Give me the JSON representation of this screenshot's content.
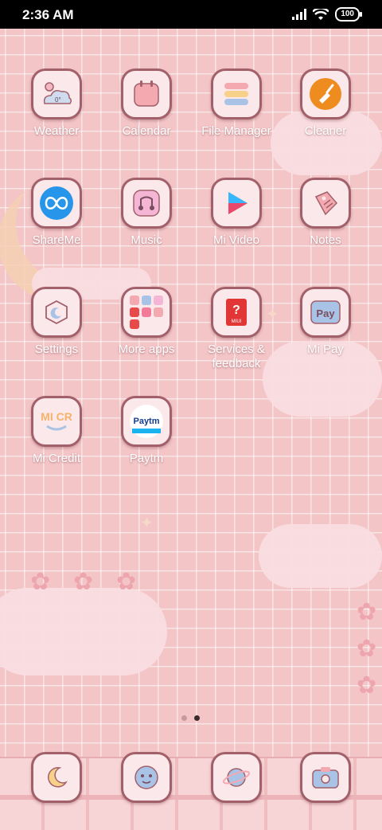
{
  "status_bar": {
    "time": "2:36 AM",
    "battery": "100"
  },
  "apps": [
    {
      "label": "Weather",
      "icon": "weather-icon",
      "badge": "0°"
    },
    {
      "label": "Calendar",
      "icon": "calendar-icon"
    },
    {
      "label": "File Manager",
      "icon": "file-manager-icon"
    },
    {
      "label": "Cleaner",
      "icon": "cleaner-icon"
    },
    {
      "label": "ShareMe",
      "icon": "shareme-icon"
    },
    {
      "label": "Music",
      "icon": "music-icon"
    },
    {
      "label": "Mi Video",
      "icon": "mi-video-icon"
    },
    {
      "label": "Notes",
      "icon": "notes-icon"
    },
    {
      "label": "Settings",
      "icon": "settings-icon"
    },
    {
      "label": "More apps",
      "icon": "folder-icon"
    },
    {
      "label": "Services & feedback",
      "icon": "services-feedback-icon",
      "badge": "MIUI"
    },
    {
      "label": "Mi Pay",
      "icon": "mi-pay-icon",
      "badge": "Pay"
    },
    {
      "label": "Mi Credit",
      "icon": "mi-credit-icon",
      "badge": "MI CR"
    },
    {
      "label": "Paytm",
      "icon": "paytm-icon",
      "badge": "Paytm"
    }
  ],
  "page_indicator": {
    "pages": 2,
    "current": 2
  },
  "dock": [
    {
      "icon": "phone-icon"
    },
    {
      "icon": "messages-icon"
    },
    {
      "icon": "browser-icon"
    },
    {
      "icon": "camera-icon"
    }
  ],
  "colors": {
    "icon_border": "#a1606a",
    "wallpaper": "#f3c5c7"
  }
}
